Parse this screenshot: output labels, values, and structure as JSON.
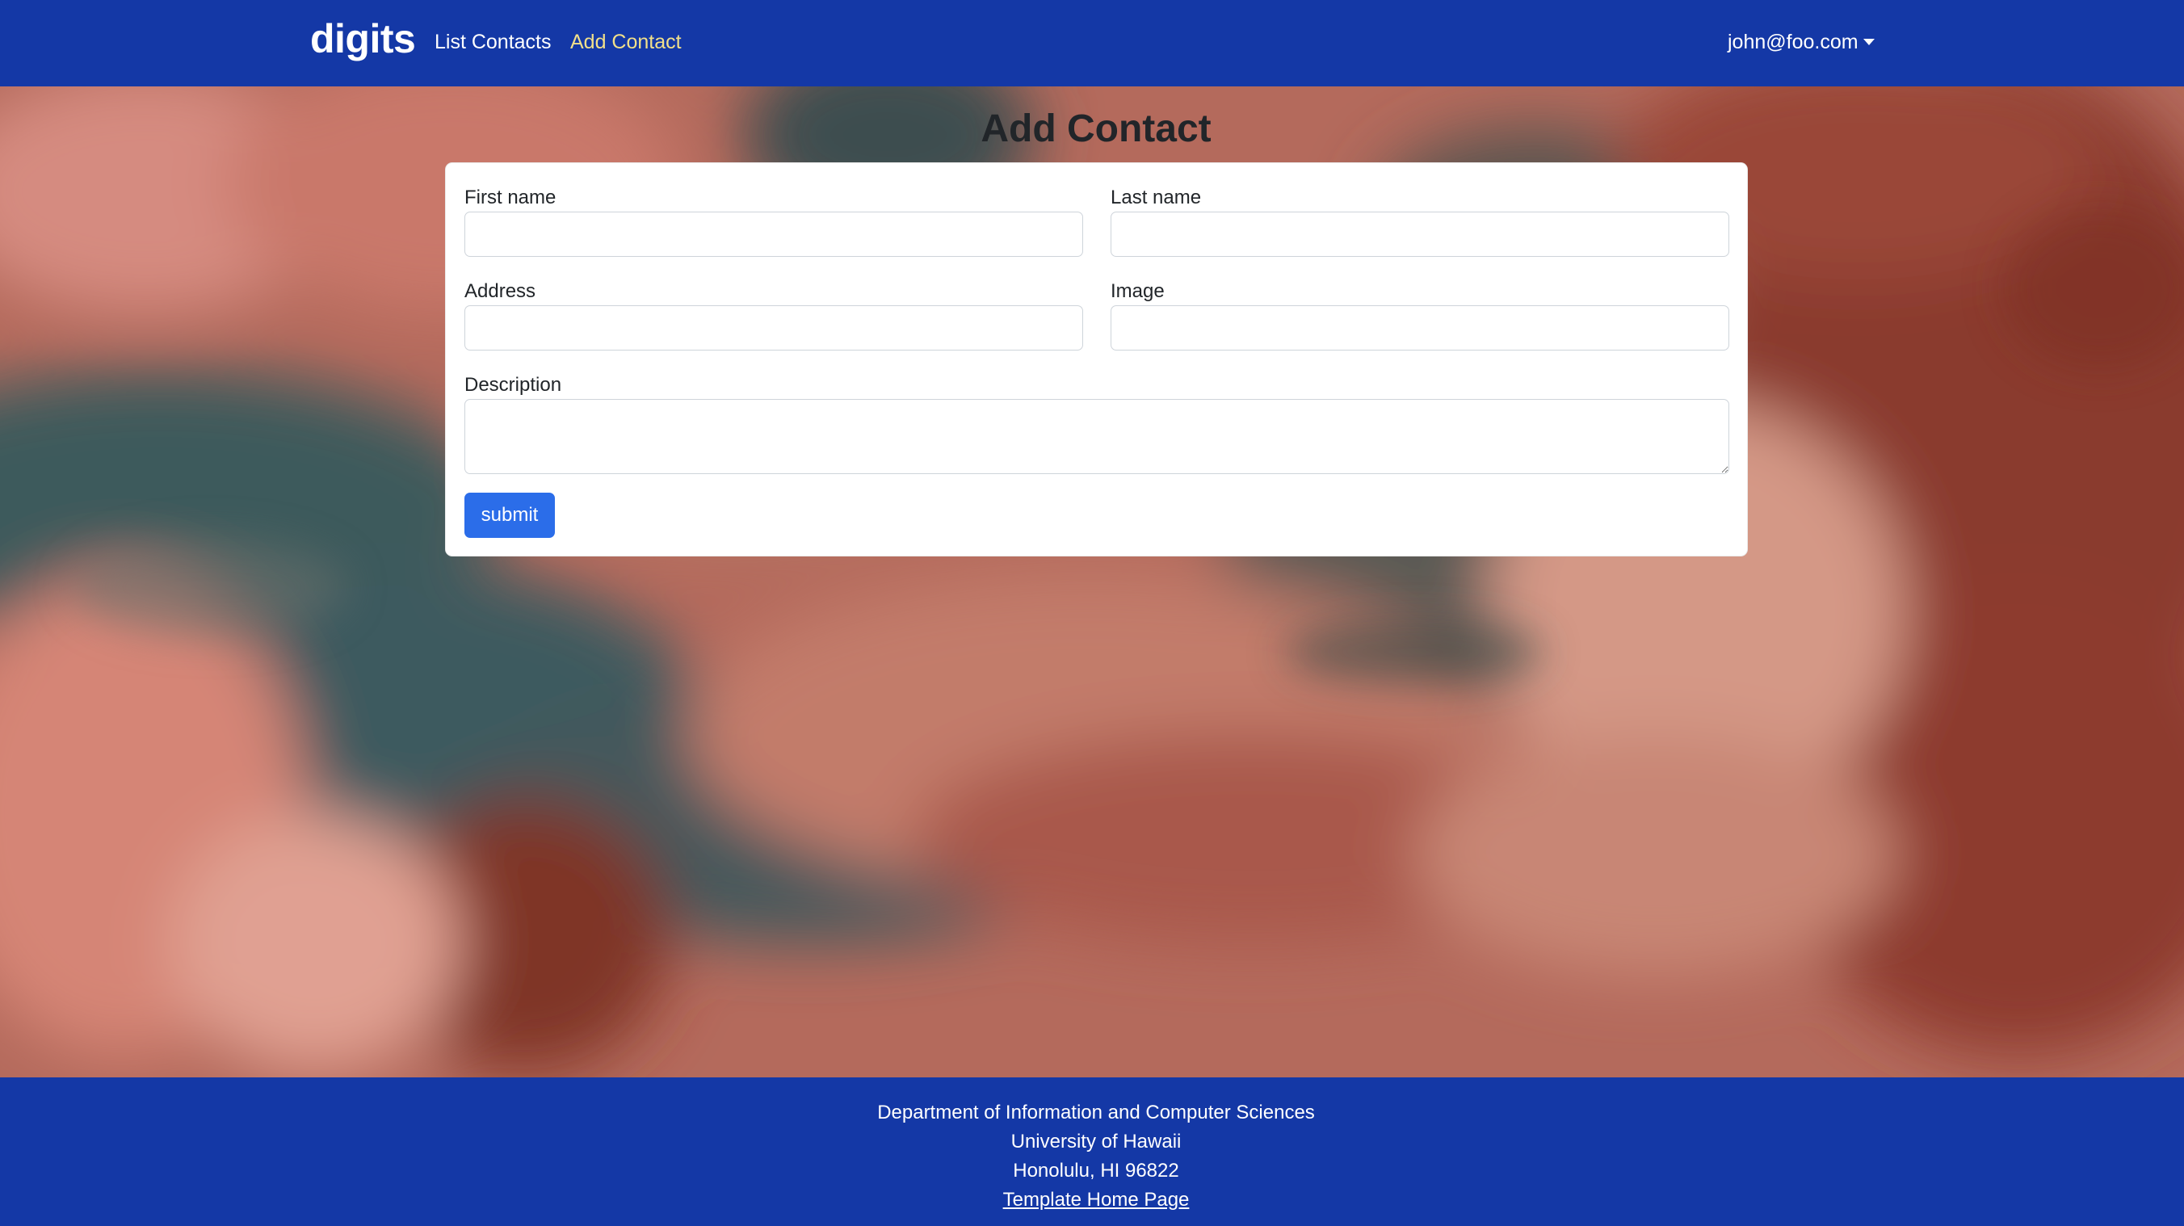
{
  "navbar": {
    "brand": "digits",
    "links": [
      {
        "label": "List Contacts",
        "active": false
      },
      {
        "label": "Add Contact",
        "active": true
      }
    ],
    "user": "john@foo.com",
    "colors": {
      "background": "#1438a6",
      "active_link": "#f2e08a"
    }
  },
  "page": {
    "title": "Add Contact"
  },
  "form": {
    "fields": {
      "first_name": {
        "label": "First name",
        "value": "",
        "placeholder": ""
      },
      "last_name": {
        "label": "Last name",
        "value": "",
        "placeholder": ""
      },
      "address": {
        "label": "Address",
        "value": "",
        "placeholder": ""
      },
      "image": {
        "label": "Image",
        "value": "",
        "placeholder": ""
      },
      "description": {
        "label": "Description",
        "value": "",
        "placeholder": ""
      }
    },
    "submit_label": "submit",
    "colors": {
      "submit_button": "#2b6de9"
    }
  },
  "footer": {
    "lines": [
      "Department of Information and Computer Sciences",
      "University of Hawaii",
      "Honolulu, HI 96822"
    ],
    "link_label": "Template Home Page"
  }
}
